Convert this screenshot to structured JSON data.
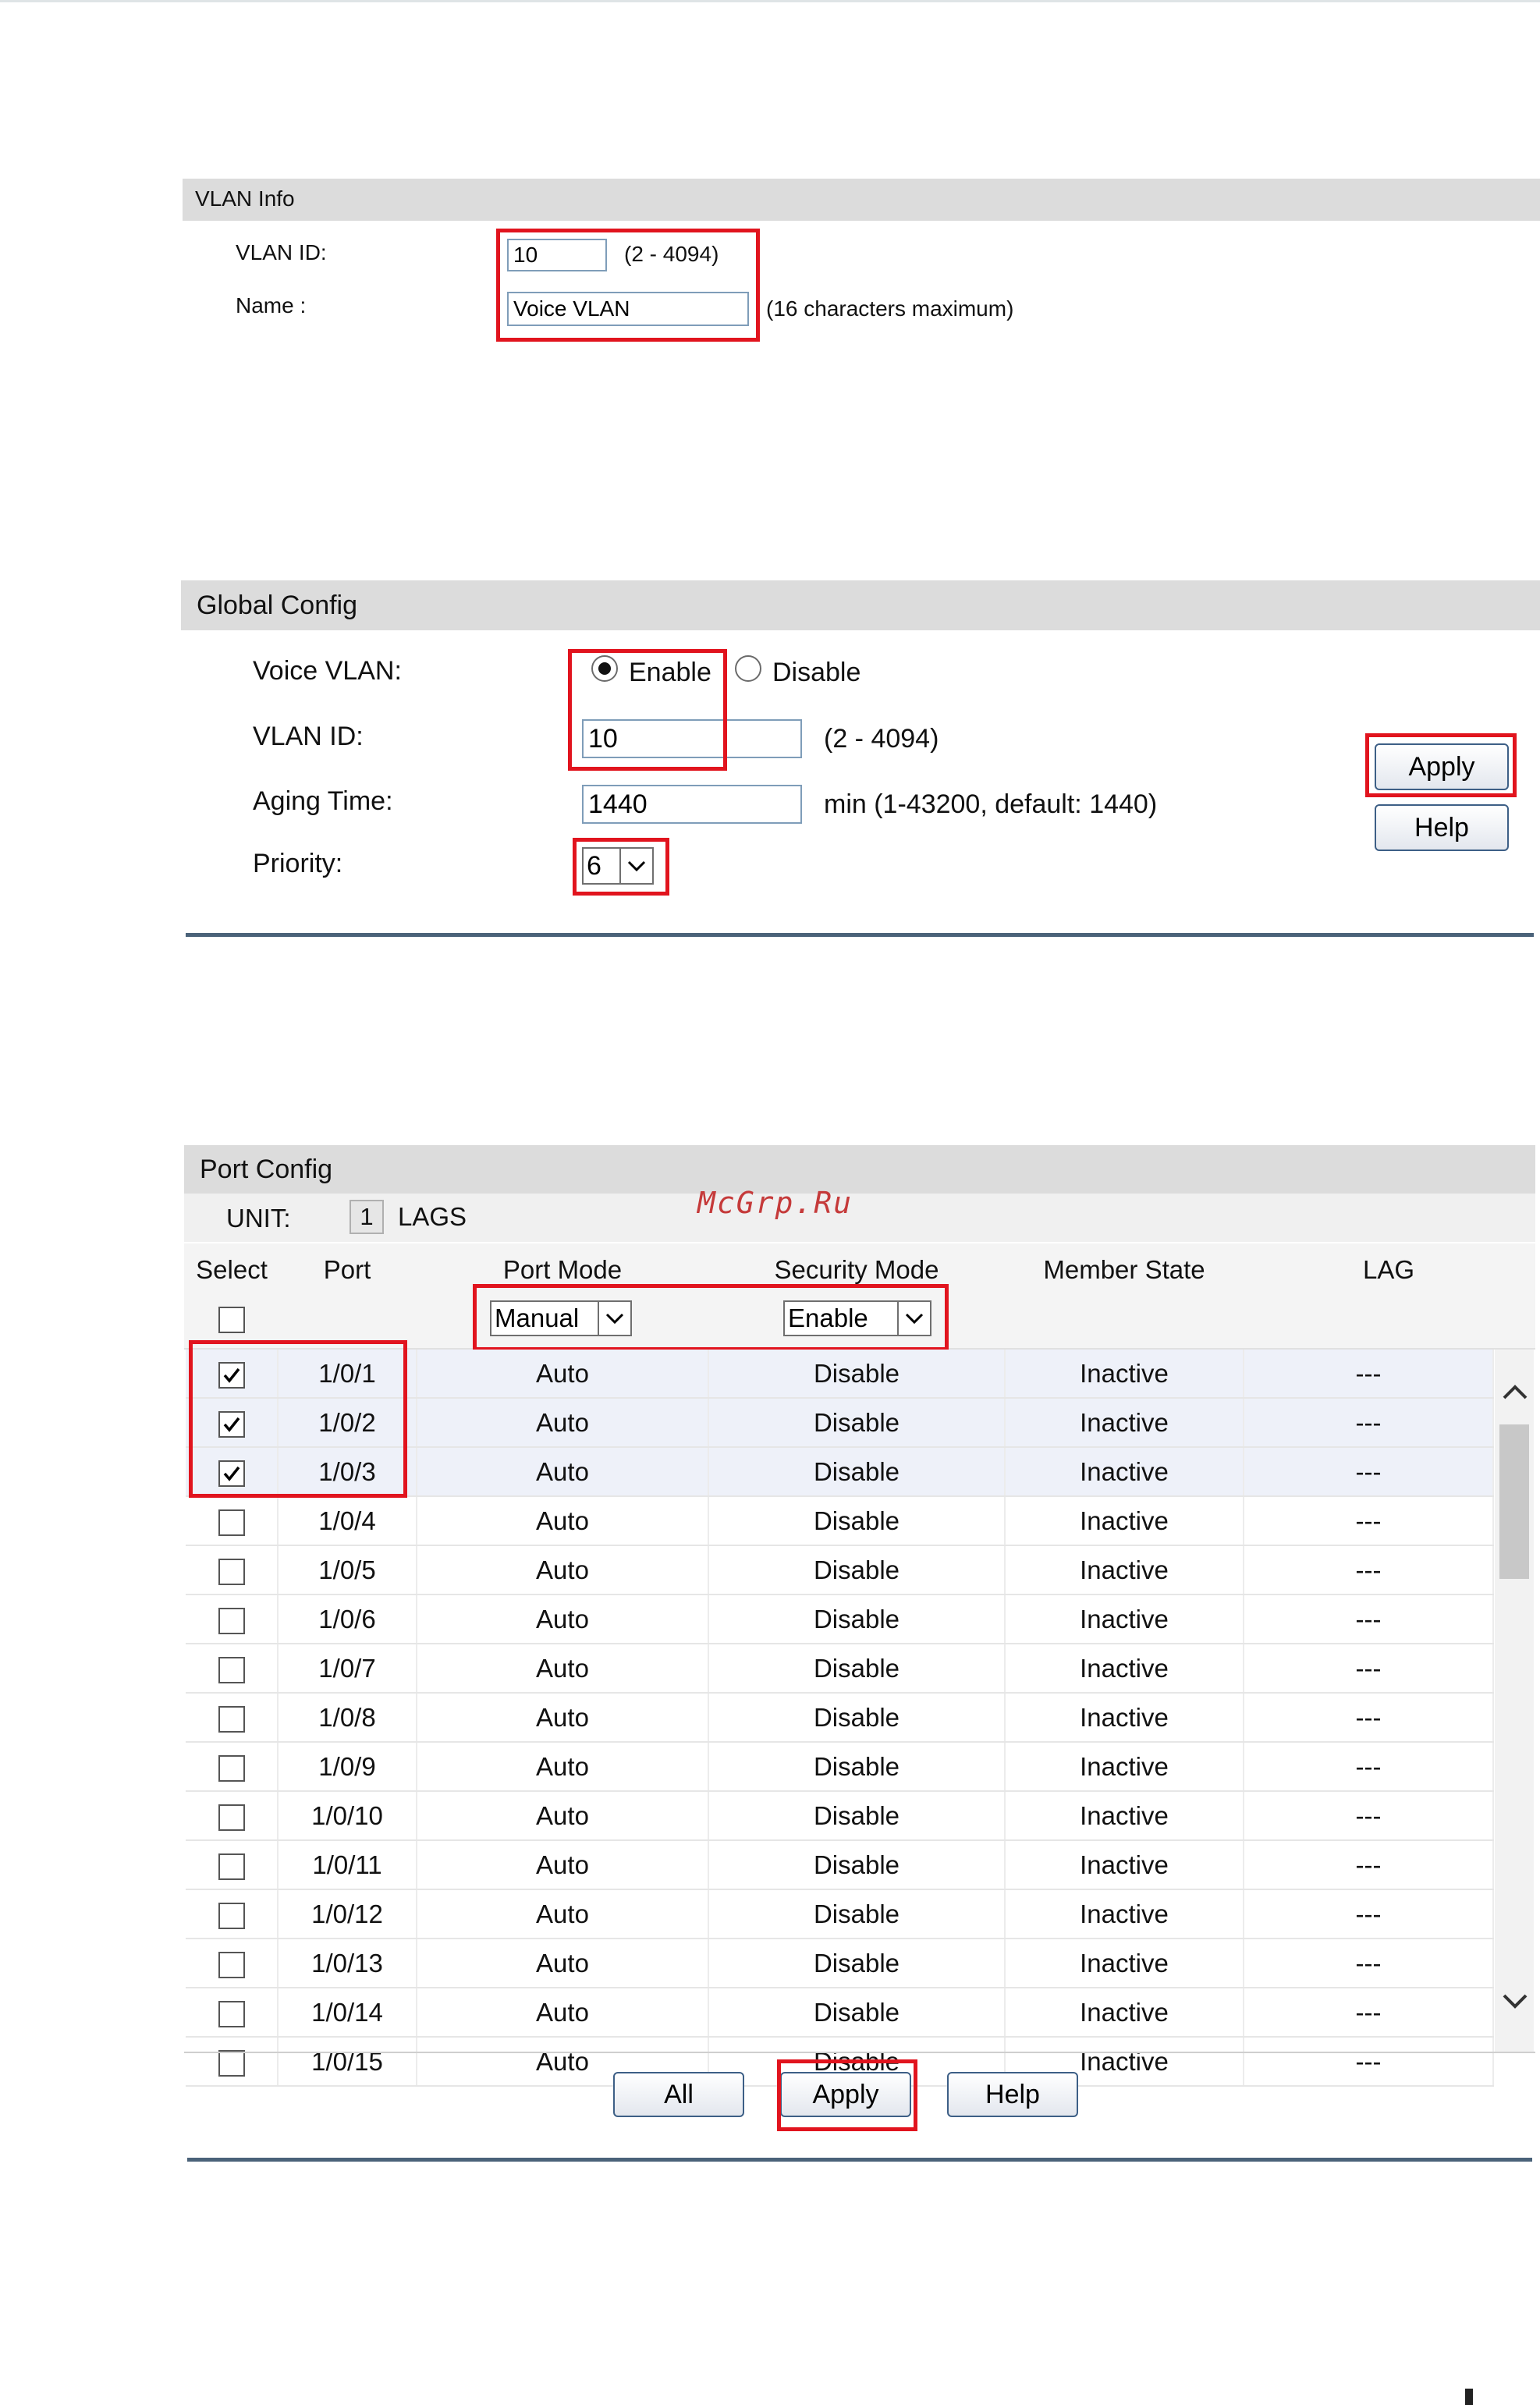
{
  "vlan_info": {
    "title": "VLAN Info",
    "vlan_id_label": "VLAN ID:",
    "vlan_id_value": "10",
    "vlan_id_hint": "(2 - 4094)",
    "name_label": "Name :",
    "name_value": "Voice VLAN",
    "name_hint": "(16 characters maximum)"
  },
  "global_config": {
    "title": "Global Config",
    "voice_vlan_label": "Voice VLAN:",
    "enable_label": "Enable",
    "disable_label": "Disable",
    "selected": "Enable",
    "vlan_id_label": "VLAN ID:",
    "vlan_id_value": "10",
    "vlan_id_hint": "(2 - 4094)",
    "aging_label": "Aging Time:",
    "aging_value": "1440",
    "aging_hint": "min (1-43200, default: 1440)",
    "priority_label": "Priority:",
    "priority_value": "6",
    "apply_label": "Apply",
    "help_label": "Help"
  },
  "port_config": {
    "title": "Port Config",
    "unit_label": "UNIT:",
    "unit_value": "1",
    "lags_label": "LAGS",
    "columns": [
      "Select",
      "Port",
      "Port Mode",
      "Security Mode",
      "Member State",
      "LAG"
    ],
    "port_mode_filter": "Manual",
    "security_mode_filter": "Enable",
    "rows": [
      {
        "checked": true,
        "port": "1/0/1",
        "port_mode": "Auto",
        "security_mode": "Disable",
        "member_state": "Inactive",
        "lag": "---"
      },
      {
        "checked": true,
        "port": "1/0/2",
        "port_mode": "Auto",
        "security_mode": "Disable",
        "member_state": "Inactive",
        "lag": "---"
      },
      {
        "checked": true,
        "port": "1/0/3",
        "port_mode": "Auto",
        "security_mode": "Disable",
        "member_state": "Inactive",
        "lag": "---"
      },
      {
        "checked": false,
        "port": "1/0/4",
        "port_mode": "Auto",
        "security_mode": "Disable",
        "member_state": "Inactive",
        "lag": "---"
      },
      {
        "checked": false,
        "port": "1/0/5",
        "port_mode": "Auto",
        "security_mode": "Disable",
        "member_state": "Inactive",
        "lag": "---"
      },
      {
        "checked": false,
        "port": "1/0/6",
        "port_mode": "Auto",
        "security_mode": "Disable",
        "member_state": "Inactive",
        "lag": "---"
      },
      {
        "checked": false,
        "port": "1/0/7",
        "port_mode": "Auto",
        "security_mode": "Disable",
        "member_state": "Inactive",
        "lag": "---"
      },
      {
        "checked": false,
        "port": "1/0/8",
        "port_mode": "Auto",
        "security_mode": "Disable",
        "member_state": "Inactive",
        "lag": "---"
      },
      {
        "checked": false,
        "port": "1/0/9",
        "port_mode": "Auto",
        "security_mode": "Disable",
        "member_state": "Inactive",
        "lag": "---"
      },
      {
        "checked": false,
        "port": "1/0/10",
        "port_mode": "Auto",
        "security_mode": "Disable",
        "member_state": "Inactive",
        "lag": "---"
      },
      {
        "checked": false,
        "port": "1/0/11",
        "port_mode": "Auto",
        "security_mode": "Disable",
        "member_state": "Inactive",
        "lag": "---"
      },
      {
        "checked": false,
        "port": "1/0/12",
        "port_mode": "Auto",
        "security_mode": "Disable",
        "member_state": "Inactive",
        "lag": "---"
      },
      {
        "checked": false,
        "port": "1/0/13",
        "port_mode": "Auto",
        "security_mode": "Disable",
        "member_state": "Inactive",
        "lag": "---"
      },
      {
        "checked": false,
        "port": "1/0/14",
        "port_mode": "Auto",
        "security_mode": "Disable",
        "member_state": "Inactive",
        "lag": "---"
      },
      {
        "checked": false,
        "port": "1/0/15",
        "port_mode": "Auto",
        "security_mode": "Disable",
        "member_state": "Inactive",
        "lag": "---"
      }
    ],
    "all_label": "All",
    "apply_label": "Apply",
    "help_label": "Help"
  },
  "watermark": "McGrp.Ru",
  "colors": {
    "highlight": "#e1141e",
    "header_bg": "#dcdcdc",
    "separator": "#4a6279"
  }
}
